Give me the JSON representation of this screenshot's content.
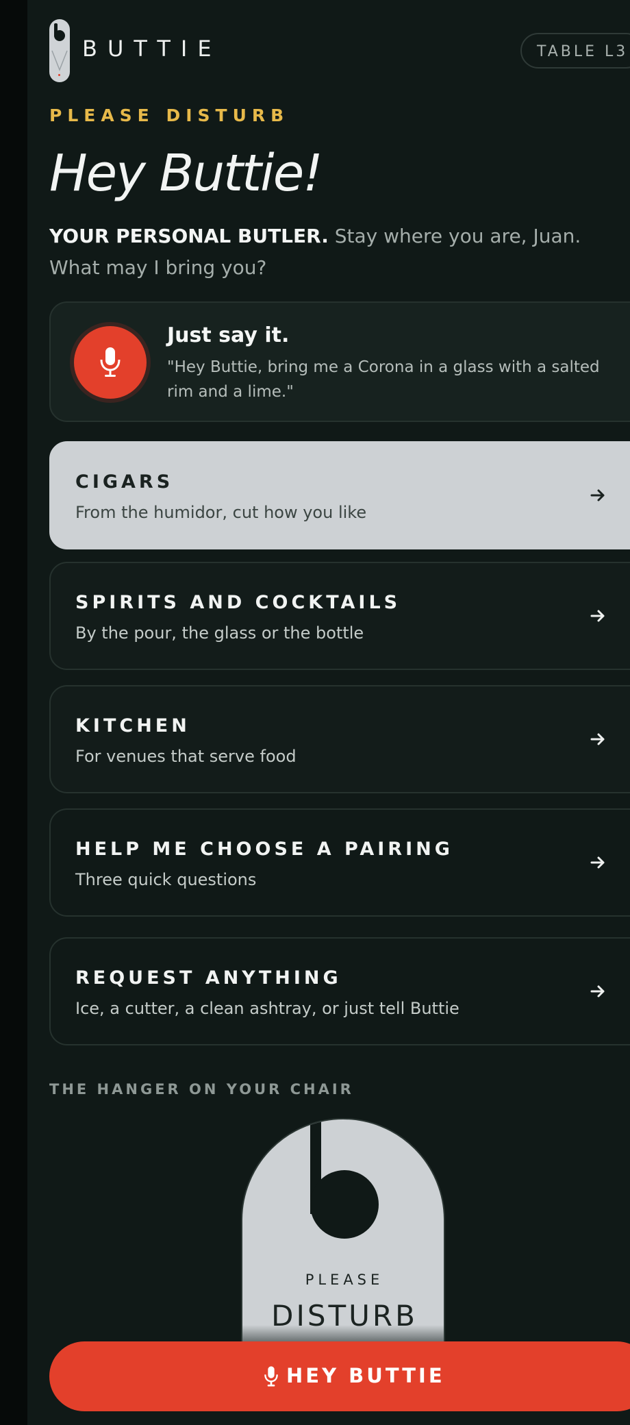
{
  "header": {
    "brand": "BUTTIE",
    "table": "TABLE L3"
  },
  "hero": {
    "eyebrow": "PLEASE DISTURB",
    "title": "Hey Buttie!",
    "intro_bold": "YOUR PERSONAL BUTLER.",
    "intro_rest": " Stay where you are, Juan. What may I bring you?"
  },
  "voice": {
    "icon": "microphone-icon",
    "title": "Just say it.",
    "example": "\"Hey Buttie, bring me a Corona in a glass with a salted rim and a lime.\""
  },
  "menu": [
    {
      "title": "CIGARS",
      "subtitle": "From the humidor, cut how you like"
    },
    {
      "title": "SPIRITS AND COCKTAILS",
      "subtitle": "By the pour, the glass or the bottle"
    },
    {
      "title": "KITCHEN",
      "subtitle": "For venues that serve food"
    },
    {
      "title": "HELP ME CHOOSE A PAIRING",
      "subtitle": "Three quick questions"
    },
    {
      "title": "REQUEST ANYTHING",
      "subtitle": "Ice, a cutter, a clean ashtray, or just tell Buttie"
    }
  ],
  "hanger_section": {
    "label": "THE HANGER ON YOUR CHAIR",
    "line1": "PLEASE",
    "line2": "DISTURB"
  },
  "cta": {
    "label": "HEY BUTTIE",
    "icon": "microphone-icon"
  },
  "colors": {
    "background": "#101917",
    "accent": "#e3402b",
    "eyebrow": "#e7b94a",
    "card_active": "#cdd1d4"
  }
}
